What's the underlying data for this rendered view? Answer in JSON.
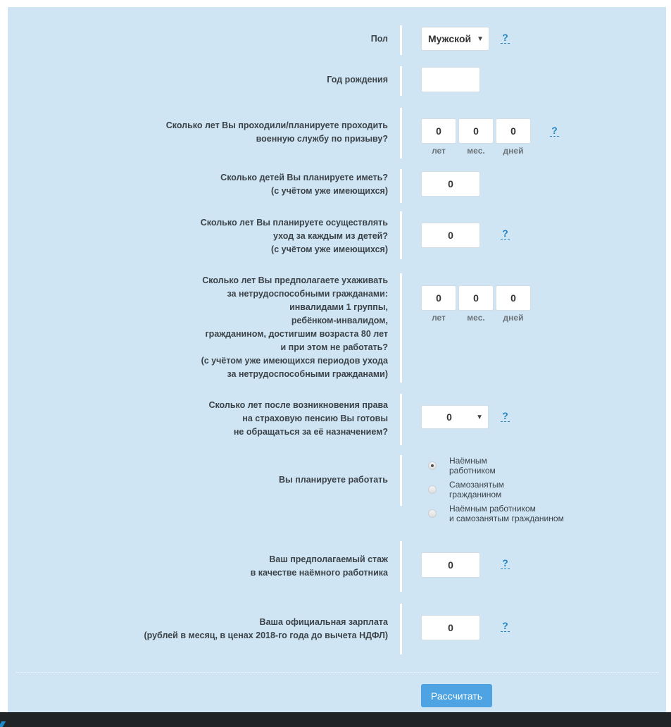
{
  "form": {
    "gender": {
      "label": "Пол",
      "selected": "Мужской",
      "help": "?"
    },
    "birth_year": {
      "label": "Год рождения",
      "value": ""
    },
    "military_service": {
      "label_lines": [
        "Сколько лет Вы проходили/планируете проходить",
        "военную службу по призыву?"
      ],
      "years": "0",
      "months": "0",
      "days": "0",
      "units": {
        "years": "лет",
        "months": "мес.",
        "days": "дней"
      },
      "help": "?"
    },
    "children_count": {
      "label_lines": [
        "Сколько детей Вы планируете иметь?",
        "(с учётом уже имеющихся)"
      ],
      "value": "0"
    },
    "childcare_years": {
      "label_lines": [
        "Сколько лет Вы планируете осуществлять",
        "уход за каждым из детей?",
        "(с учётом уже имеющихся)"
      ],
      "value": "0",
      "help": "?"
    },
    "disabled_care": {
      "label_lines": [
        "Сколько лет Вы предполагаете ухаживать",
        "за нетрудоспособными гражданами:",
        "инвалидами 1 группы,",
        "ребёнком-инвалидом,",
        "гражданином, достигшим возраста 80 лет",
        "и при этом не работать?",
        "(с учётом уже имеющихся периодов ухода",
        "за нетрудоспособными гражданами)"
      ],
      "years": "0",
      "months": "0",
      "days": "0",
      "units": {
        "years": "лет",
        "months": "мес.",
        "days": "дней"
      }
    },
    "deferral_years": {
      "label_lines": [
        "Сколько лет после возникновения права",
        "на страховую пенсию Вы готовы",
        "не обращаться за её назначением?"
      ],
      "selected": "0",
      "help": "?"
    },
    "employment": {
      "label": "Вы планируете работать",
      "options": [
        {
          "label_lines": [
            "Наёмным",
            "работником"
          ],
          "checked": true
        },
        {
          "label_lines": [
            "Самозанятым",
            "гражданином"
          ],
          "checked": false
        },
        {
          "label_lines": [
            "Наёмным работником",
            "и самозанятым гражданином"
          ],
          "checked": false
        }
      ]
    },
    "employee_experience": {
      "label_lines": [
        "Ваш предполагаемый стаж",
        "в качестве наёмного работника"
      ],
      "value": "0",
      "help": "?"
    },
    "salary": {
      "label_lines": [
        "Ваша официальная зарплата",
        "(рублей в месяц, в ценах 2018-го года до вычета НДФЛ)"
      ],
      "value": "0",
      "help": "?"
    },
    "submit_label": "Рассчитать"
  },
  "colors": {
    "panel_bg": "#cfe5f3",
    "accent": "#4ea3e3",
    "help_link": "#2585c2",
    "footer": "#212427"
  }
}
